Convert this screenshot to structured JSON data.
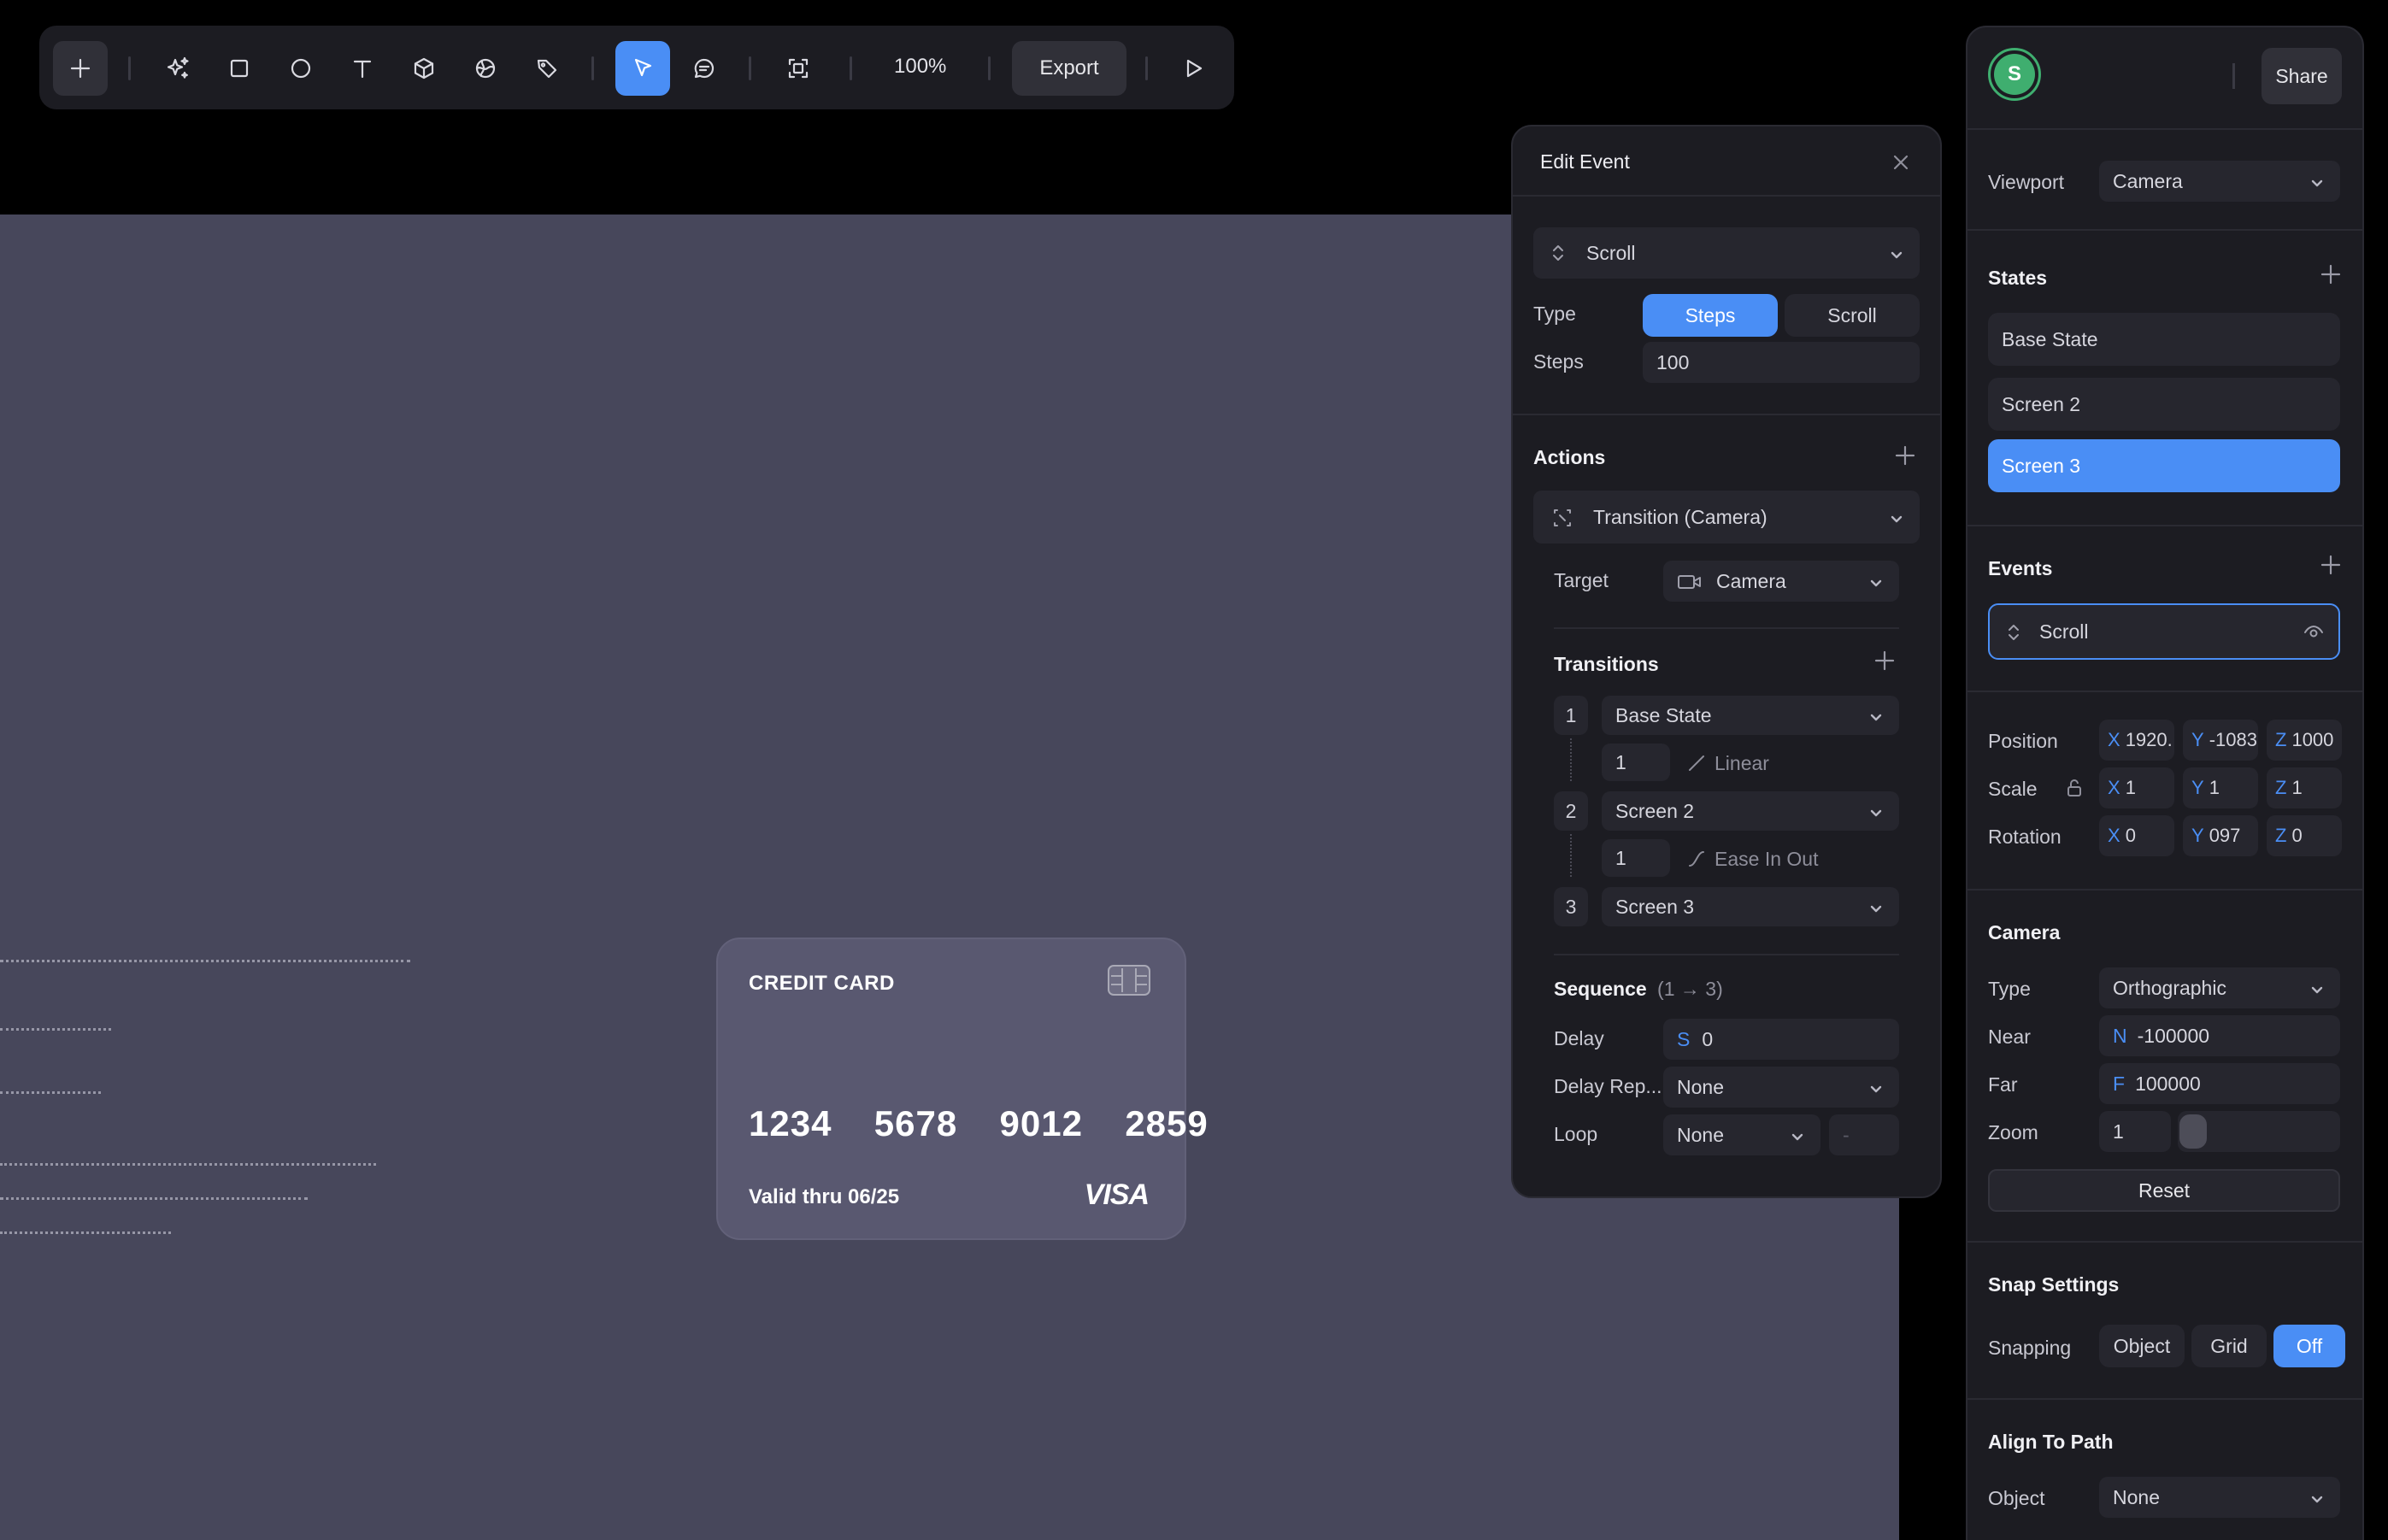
{
  "toolbar": {
    "zoom": "100%",
    "export_label": "Export",
    "tools": [
      "add-icon",
      "ai-sparkle-icon",
      "rectangle-icon",
      "ellipse-icon",
      "text-icon",
      "cube-icon",
      "globe-icon",
      "tag-icon",
      "pointer-icon",
      "comment-icon",
      "frame-icon",
      "play-icon"
    ],
    "active_tool": "pointer-icon"
  },
  "card": {
    "title": "CREDIT CARD",
    "number": "1234  5678  9012  2859",
    "valid": "Valid thru 06/25",
    "brand": "VISA"
  },
  "edit_event": {
    "title": "Edit Event",
    "event_select": "Scroll",
    "type_label": "Type",
    "type_options": [
      "Steps",
      "Scroll"
    ],
    "type_selected": "Steps",
    "steps_label": "Steps",
    "steps_value": "100",
    "actions_header": "Actions",
    "action_select": "Transition (Camera)",
    "target_label": "Target",
    "target_value": "Camera",
    "transitions_header": "Transitions",
    "transitions": [
      {
        "index": "1",
        "state": "Base State",
        "duration": "1",
        "easing": "Linear"
      },
      {
        "index": "2",
        "state": "Screen 2",
        "duration": "1",
        "easing": "Ease In Out"
      },
      {
        "index": "3",
        "state": "Screen 3"
      }
    ],
    "sequence_header": "Sequence",
    "sequence_range": "(1 → 3)",
    "delay_label": "Delay",
    "delay_prefix": "S",
    "delay_value": "0",
    "delay_repeat_label": "Delay Rep...",
    "delay_repeat_value": "None",
    "loop_label": "Loop",
    "loop_value": "None",
    "loop_extra": "-"
  },
  "right_panel": {
    "avatar_letter": "S",
    "share_label": "Share",
    "viewport_label": "Viewport",
    "viewport_value": "Camera",
    "states_header": "States",
    "states": [
      "Base State",
      "Screen 2",
      "Screen 3"
    ],
    "selected_state": "Screen 3",
    "events_header": "Events",
    "event_item": "Scroll",
    "position_label": "Position",
    "position": {
      "x": "1920.",
      "y": "-1083",
      "z": "1000"
    },
    "scale_label": "Scale",
    "scale": {
      "x": "1",
      "y": "1",
      "z": "1"
    },
    "rotation_label": "Rotation",
    "rotation": {
      "x": "0",
      "y": "097",
      "z": "0"
    },
    "camera_header": "Camera",
    "camera_type_label": "Type",
    "camera_type_value": "Orthographic",
    "near_label": "Near",
    "near_prefix": "N",
    "near_value": "-100000",
    "far_label": "Far",
    "far_prefix": "F",
    "far_value": "100000",
    "zoom_label": "Zoom",
    "zoom_value": "1",
    "reset_label": "Reset",
    "snap_header": "Snap Settings",
    "snapping_label": "Snapping",
    "snapping_options": [
      "Object",
      "Grid",
      "Off"
    ],
    "snapping_selected": "Off",
    "align_header": "Align To Path",
    "object_label": "Object",
    "object_value": "None"
  },
  "colors": {
    "accent": "#4a8ef5",
    "canvas": "#47475b",
    "panel": "#1c1c22",
    "avatar": "#3fae6f"
  }
}
